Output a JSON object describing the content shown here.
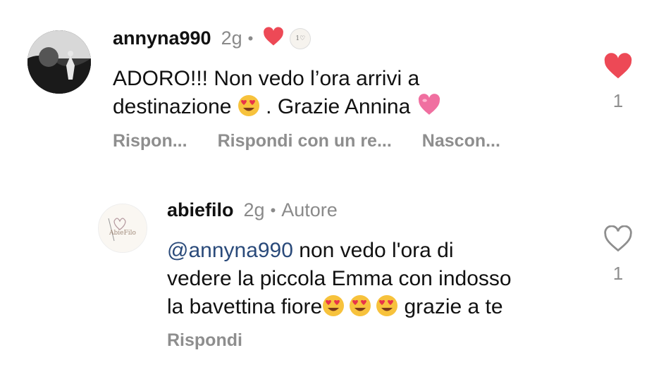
{
  "comments": [
    {
      "username": "annyna990",
      "time": "2g",
      "separator": "•",
      "creator_badge_text": "1♡",
      "text_line1": "ADORO!!! Non vedo l’ora arrivi a",
      "text_line2_a": "destinazione",
      "text_line2_b": ". Grazie Annina",
      "actions": [
        "Rispon...",
        "Rispondi con un re...",
        "Nascon..."
      ],
      "like_count": "1",
      "liked": true
    },
    {
      "username": "abiefilo",
      "time": "2g",
      "separator": "•",
      "author_label": "Autore",
      "avatar_text": "AbieFilo",
      "mention": "@annyna990",
      "text_line1_rest": " non vedo l'ora di",
      "text_line2": "vedere la piccola Emma con indosso",
      "text_line3_a": "la bavettina fiore",
      "text_line3_b": " grazie a te",
      "actions": [
        "Rispondi"
      ],
      "like_count": "1",
      "liked": false
    }
  ],
  "colors": {
    "like_red": "#ed4956",
    "muted": "#8e8e8e",
    "mention": "#2a4a7a"
  },
  "icons": {
    "filled_heart": "heart-filled-icon",
    "outline_heart": "heart-outline-icon",
    "heart_eyes": "heart-eyes-emoji",
    "pink_heart": "pink-heart-emoji"
  }
}
